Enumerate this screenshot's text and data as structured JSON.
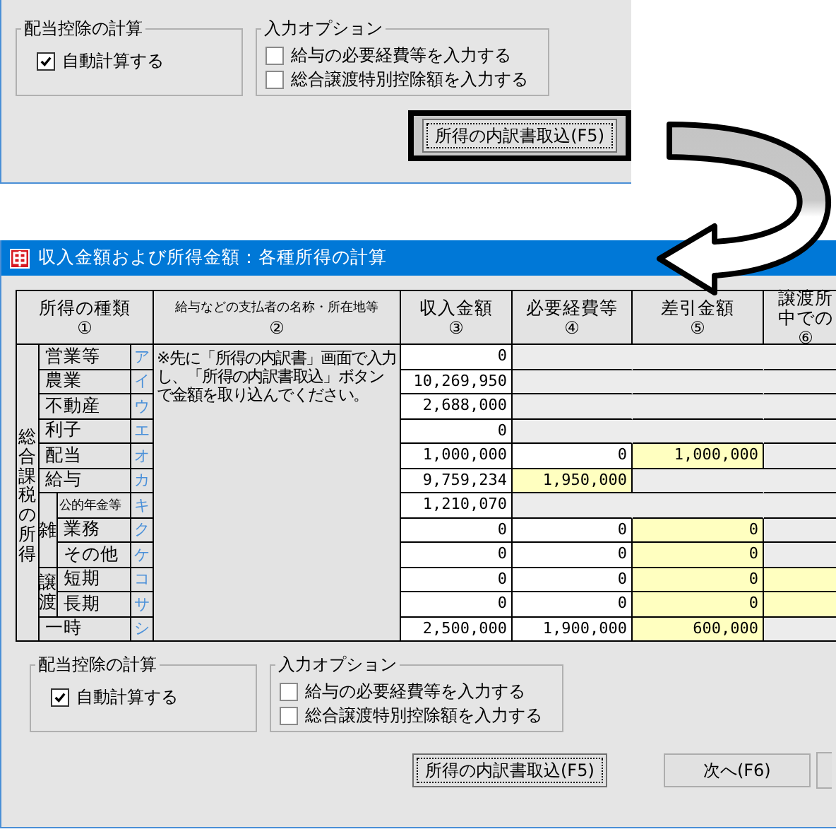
{
  "top_panel": {
    "groups": [
      {
        "title": "配当控除の計算",
        "options": [
          {
            "label": "自動計算する",
            "checked": true
          }
        ]
      },
      {
        "title": "入力オプション",
        "options": [
          {
            "label": "給与の必要経費等を入力する",
            "checked": false
          },
          {
            "label": "総合譲渡特別控除額を入力する",
            "checked": false
          }
        ]
      }
    ],
    "buttons": [
      {
        "kind": "button",
        "label": "所得の内訳書取込(F5)",
        "callout": true
      }
    ]
  },
  "window": {
    "title": "収入金額および所得金額：各種所得の計算",
    "table": {
      "columns": [
        {
          "lines": [
            "所得の種類"
          ],
          "number": "①"
        },
        {
          "lines": [
            "給与などの支払者の名称・所在地等"
          ],
          "number": "②"
        },
        {
          "lines": [
            "収入金額"
          ],
          "number": "③"
        },
        {
          "lines": [
            "必要経費等"
          ],
          "number": "④"
        },
        {
          "lines": [
            "差引金額"
          ],
          "number": "⑤"
        },
        {
          "lines": [
            "譲渡所",
            "中での"
          ],
          "number": "⑥"
        }
      ],
      "group_label": "総合課税の所得",
      "note": "※先に「所得の内訳書」画面で入力し、「所得の内訳書取込」ボタンで金額を取り込んでください。",
      "rows": [
        {
          "kind": "item",
          "label": "営業等",
          "kana": "ア",
          "cells": [
            {
              "kind": "input",
              "text": "0"
            },
            {
              "kind": "blank"
            },
            {
              "kind": "blank"
            },
            {
              "kind": "blank"
            }
          ]
        },
        {
          "kind": "item",
          "label": "農業",
          "kana": "イ",
          "cells": [
            {
              "kind": "input",
              "text": "10,269,950"
            },
            {
              "kind": "blank"
            },
            {
              "kind": "blank"
            },
            {
              "kind": "blank"
            }
          ]
        },
        {
          "kind": "item",
          "label": "不動産",
          "kana": "ウ",
          "cells": [
            {
              "kind": "input",
              "text": "2,688,000"
            },
            {
              "kind": "blank"
            },
            {
              "kind": "blank"
            },
            {
              "kind": "blank"
            }
          ]
        },
        {
          "kind": "item",
          "label": "利子",
          "kana": "エ",
          "cells": [
            {
              "kind": "input",
              "text": "0"
            },
            {
              "kind": "blank"
            },
            {
              "kind": "blank"
            },
            {
              "kind": "blank"
            }
          ]
        },
        {
          "kind": "item",
          "label": "配当",
          "kana": "オ",
          "cells": [
            {
              "kind": "input",
              "text": "1,000,000"
            },
            {
              "kind": "input",
              "text": "0"
            },
            {
              "kind": "computed",
              "text": "1,000,000"
            },
            {
              "kind": "blank"
            }
          ]
        },
        {
          "kind": "item",
          "label": "給与",
          "kana": "カ",
          "cells": [
            {
              "kind": "input",
              "text": "9,759,234"
            },
            {
              "kind": "computed",
              "text": "1,950,000"
            },
            {
              "kind": "blank"
            },
            {
              "kind": "blank"
            }
          ]
        },
        {
          "kind": "group",
          "label": "雑",
          "children": [
            {
              "kind": "item",
              "label": "公的年金等",
              "kana": "キ",
              "cells": [
                {
                  "kind": "input",
                  "text": "1,210,070"
                },
                {
                  "kind": "blank"
                },
                {
                  "kind": "blank"
                },
                {
                  "kind": "blank"
                }
              ]
            },
            {
              "kind": "item",
              "label": "業務",
              "kana": "ク",
              "cells": [
                {
                  "kind": "input",
                  "text": "0"
                },
                {
                  "kind": "input",
                  "text": "0"
                },
                {
                  "kind": "computed",
                  "text": "0"
                },
                {
                  "kind": "blank"
                }
              ]
            },
            {
              "kind": "item",
              "label": "その他",
              "kana": "ケ",
              "cells": [
                {
                  "kind": "input",
                  "text": "0"
                },
                {
                  "kind": "input",
                  "text": "0"
                },
                {
                  "kind": "computed",
                  "text": "0"
                },
                {
                  "kind": "blank"
                }
              ]
            }
          ]
        },
        {
          "kind": "group",
          "label": "譲渡",
          "children": [
            {
              "kind": "item",
              "label": "短期",
              "kana": "コ",
              "cells": [
                {
                  "kind": "input",
                  "text": "0"
                },
                {
                  "kind": "input",
                  "text": "0"
                },
                {
                  "kind": "computed",
                  "text": "0"
                },
                {
                  "kind": "computed"
                }
              ]
            },
            {
              "kind": "item",
              "label": "長期",
              "kana": "サ",
              "cells": [
                {
                  "kind": "input",
                  "text": "0"
                },
                {
                  "kind": "input",
                  "text": "0"
                },
                {
                  "kind": "computed",
                  "text": "0"
                },
                {
                  "kind": "computed"
                }
              ]
            }
          ]
        },
        {
          "kind": "item",
          "label": "一時",
          "kana": "シ",
          "cells": [
            {
              "kind": "input",
              "text": "2,500,000"
            },
            {
              "kind": "input",
              "text": "1,900,000"
            },
            {
              "kind": "computed",
              "text": "600,000"
            },
            {
              "kind": "blank"
            }
          ]
        }
      ]
    },
    "groups": [
      {
        "title": "配当控除の計算",
        "options": [
          {
            "label": "自動計算する",
            "checked": true
          }
        ]
      },
      {
        "title": "入力オプション",
        "options": [
          {
            "label": "給与の必要経費等を入力する",
            "checked": false
          },
          {
            "label": "総合譲渡特別控除額を入力する",
            "checked": false
          }
        ]
      }
    ],
    "buttons": [
      {
        "kind": "button",
        "label": "所得の内訳書取込(F5)",
        "callout": false
      },
      {
        "kind": "button",
        "label": "次へ(F6)",
        "callout": false
      },
      {
        "kind": "partial"
      }
    ]
  }
}
